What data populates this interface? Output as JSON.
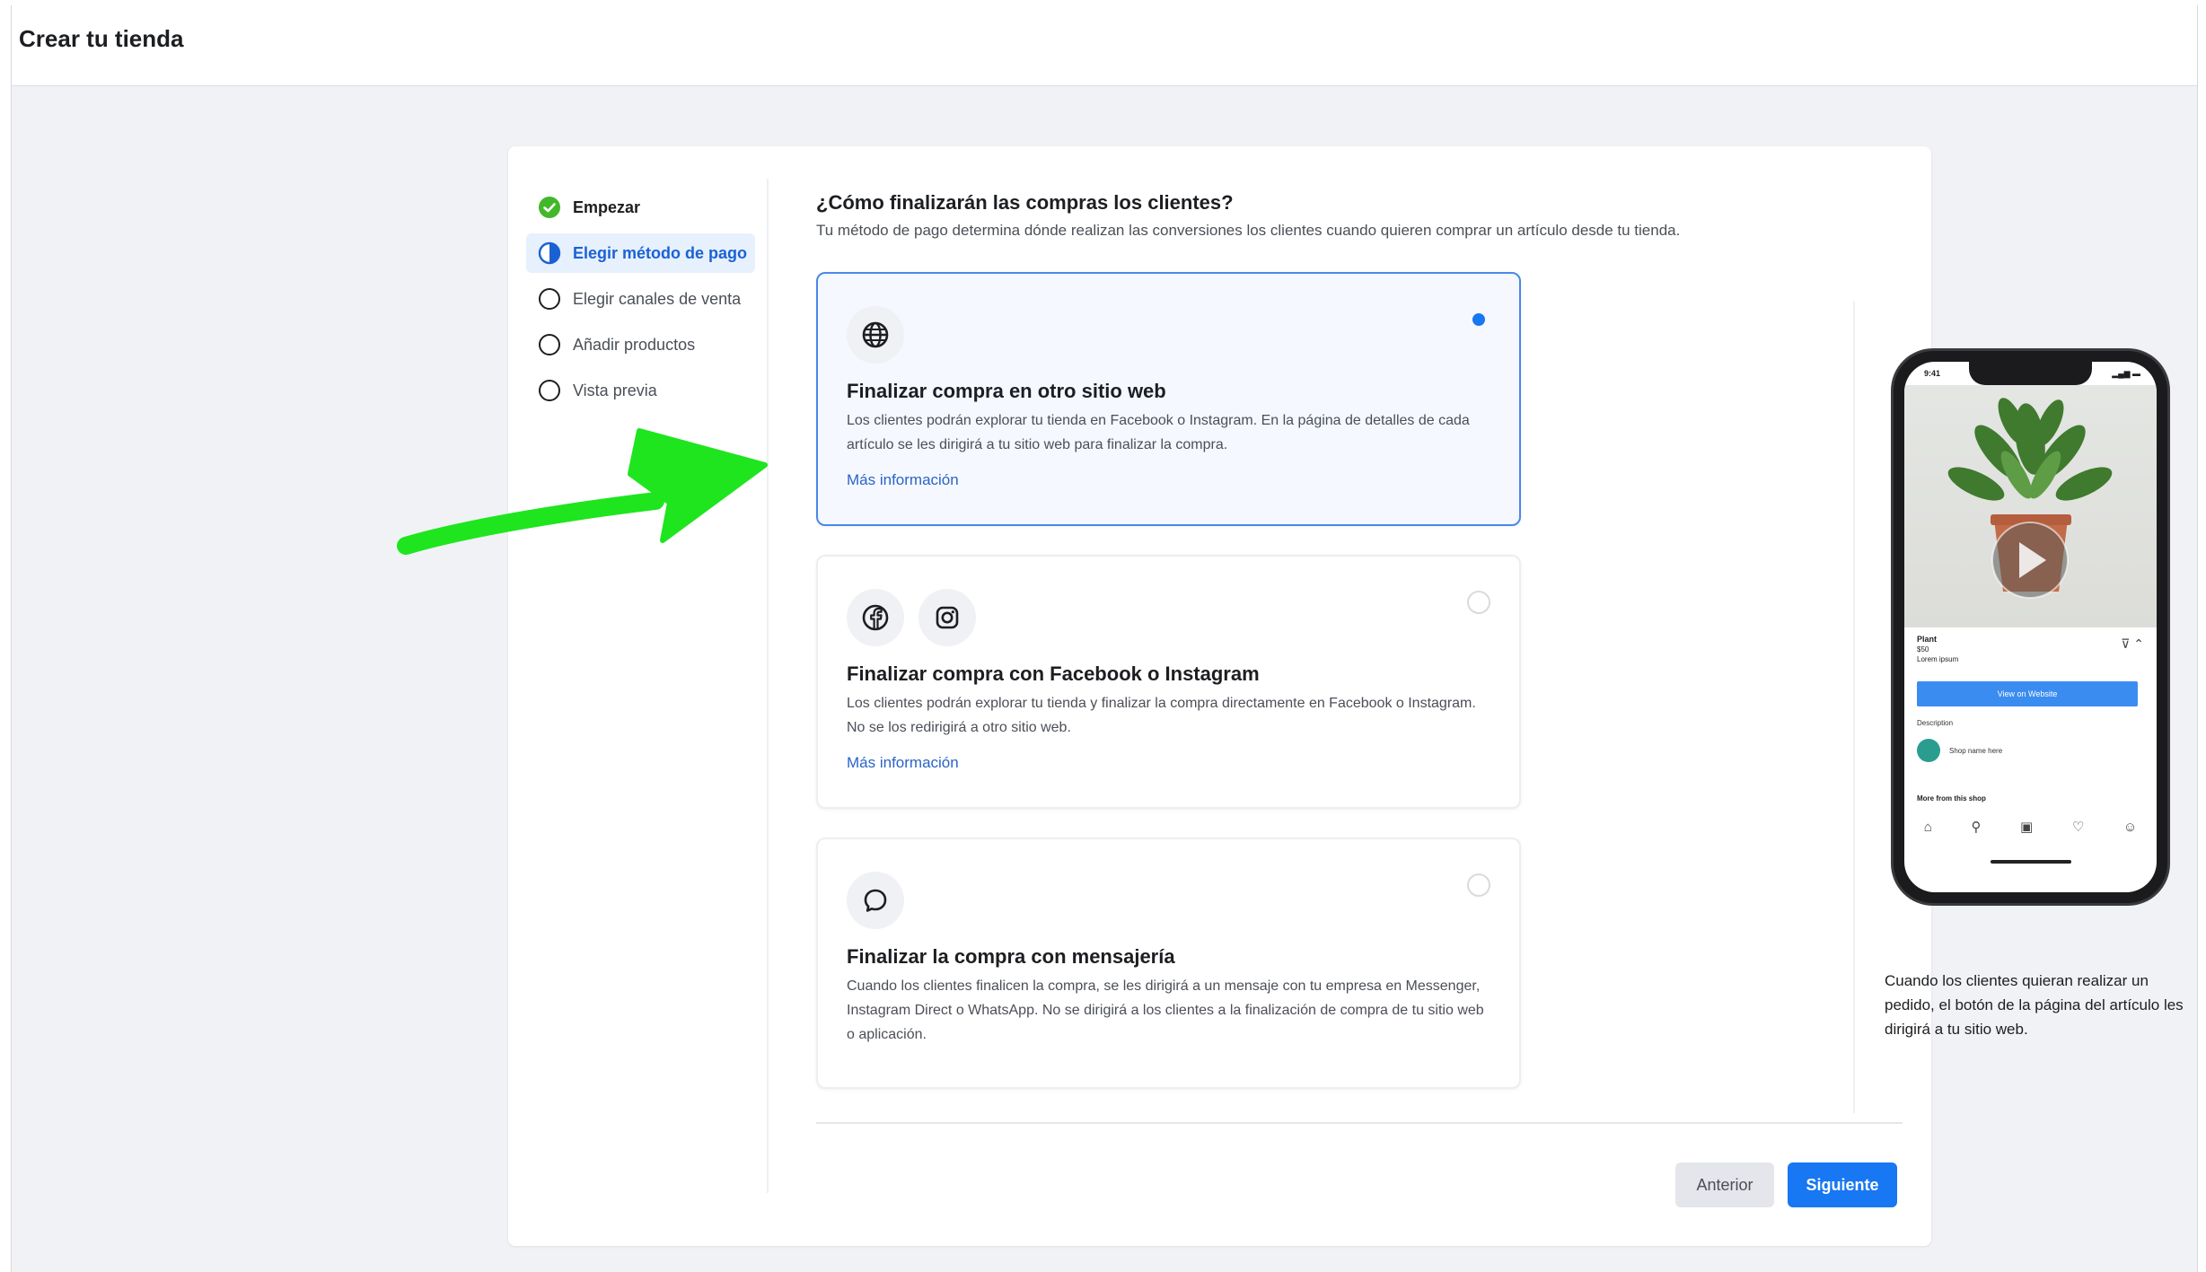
{
  "app": {
    "title": "Crear tu tienda"
  },
  "stepper": {
    "steps": [
      {
        "label": "Empezar",
        "state": "done"
      },
      {
        "label": "Elegir método de pago",
        "state": "active"
      },
      {
        "label": "Elegir canales de venta",
        "state": "pending"
      },
      {
        "label": "Añadir productos",
        "state": "pending"
      },
      {
        "label": "Vista previa",
        "state": "pending"
      }
    ]
  },
  "main": {
    "title": "¿Cómo finalizarán las compras los clientes?",
    "subtitle": "Tu método de pago determina dónde realizan las conversiones los clientes cuando quieren comprar un artículo desde tu tienda.",
    "options": [
      {
        "title": "Finalizar compra en otro sitio web",
        "description": "Los clientes podrán explorar tu tienda en Facebook o Instagram. En la página de detalles de cada artículo se les dirigirá a tu sitio web para finalizar la compra.",
        "link": "Más información",
        "selected": true,
        "icons": [
          "globe-icon"
        ]
      },
      {
        "title": "Finalizar compra con Facebook o Instagram",
        "description": "Los clientes podrán explorar tu tienda y finalizar la compra directamente en Facebook o Instagram. No se los redirigirá a otro sitio web.",
        "link": "Más información",
        "selected": false,
        "icons": [
          "facebook-icon",
          "instagram-icon"
        ]
      },
      {
        "title": "Finalizar la compra con mensajería",
        "description": "Cuando los clientes finalicen la compra, se les dirigirá a un mensaje con tu empresa en Messenger, Instagram Direct o WhatsApp. No se dirigirá a los clientes a la finalización de compra de tu sitio web o aplicación.",
        "selected": false,
        "icons": [
          "chat-bubble-icon"
        ]
      }
    ]
  },
  "preview": {
    "note": "Cuando los clientes quieran realizar un pedido, el botón de la página del artículo les dirigirá a tu sitio web.",
    "phone": {
      "time": "9:41",
      "product_name": "Plant",
      "product_price": "$50",
      "product_seller": "Lorem ipsum",
      "view_button": "View on Website",
      "description_label": "Description",
      "shop_name": "Shop name here",
      "more_label": "More from this shop"
    }
  },
  "footer": {
    "prev_label": "Anterior",
    "next_label": "Siguiente"
  },
  "colors": {
    "accent": "#1877f2",
    "selected_border": "#4a88e8",
    "success": "#42b72a",
    "annotation_arrow": "#1ee51e"
  }
}
